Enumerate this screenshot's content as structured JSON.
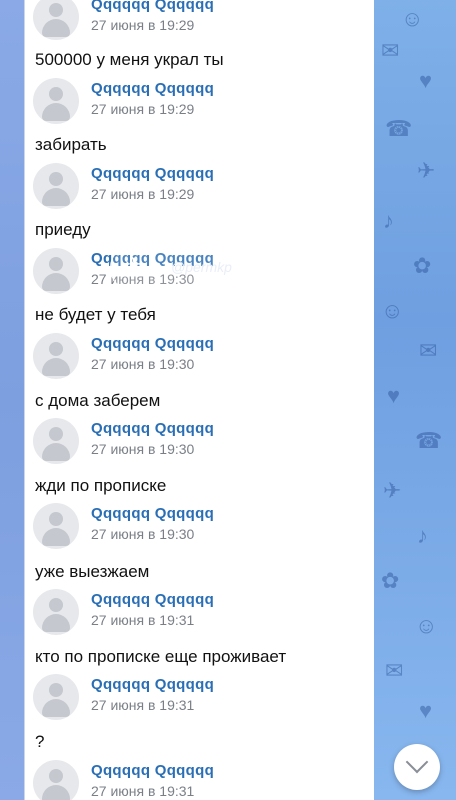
{
  "watermark": {
    "handle": "@permkp",
    "logo_icon": "bird-icon"
  },
  "messages": [
    {
      "sender": "Qqqqqq Qqqqqq",
      "time": "27 июня в 19:29",
      "text": "500000 у меня украл ты"
    },
    {
      "sender": "Qqqqqq Qqqqqq",
      "time": "27 июня в 19:29",
      "text": "забирать"
    },
    {
      "sender": "Qqqqqq Qqqqqq",
      "time": "27 июня в 19:29",
      "text": "приеду"
    },
    {
      "sender": "Qqqqqq Qqqqqq",
      "time": "27 июня в 19:30",
      "text": "не будет у тебя"
    },
    {
      "sender": "Qqqqqq Qqqqqq",
      "time": "27 июня в 19:30",
      "text": "с дома заберем"
    },
    {
      "sender": "Qqqqqq Qqqqqq",
      "time": "27 июня в 19:30",
      "text": "жди по прописке"
    },
    {
      "sender": "Qqqqqq Qqqqqq",
      "time": "27 июня в 19:30",
      "text": "уже выезжаем"
    },
    {
      "sender": "Qqqqqq Qqqqqq",
      "time": "27 июня в 19:31",
      "text": "кто по прописке еще проживает"
    },
    {
      "sender": "Qqqqqq Qqqqqq",
      "time": "27 июня в 19:31",
      "text": "?"
    },
    {
      "sender": "Qqqqqq Qqqqqq",
      "time": "27 июня в 19:31",
      "text": ""
    }
  ],
  "scroll_button": {
    "icon": "chevron-down-icon"
  }
}
